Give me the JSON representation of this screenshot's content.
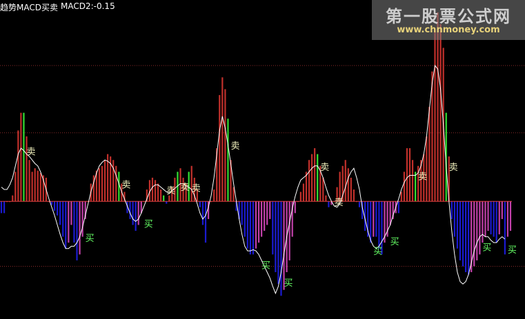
{
  "indicator": {
    "title": "趋势MACD买卖",
    "value_label": "MACD2:-0.15"
  },
  "watermark": {
    "name": "第一股票公式网",
    "url": "www.chnmoney.com"
  },
  "colors": {
    "positive_bar": "#c0302b",
    "negative_bar": "#1b1bd0",
    "weak_negative_bar": "#c040a8",
    "signal_bar": "#33dd33",
    "line": "#ffffff",
    "grid": "#8a2b2b",
    "zero_line": "#e04040",
    "signal_text": "#66ff66"
  },
  "chart_data": {
    "type": "bar",
    "title": "趋势MACD买卖",
    "legend": [
      "MACD2:-0.15"
    ],
    "grid": true,
    "ylim": [
      -0.95,
      1.6
    ],
    "gridlines": [
      1.15,
      0.58,
      -0.55
    ],
    "series": [
      {
        "name": "MACD2",
        "kind": "bar",
        "values": [
          -0.1,
          -0.1,
          0.0,
          0.0,
          0.05,
          0.25,
          0.6,
          0.75,
          0.75,
          0.55,
          0.35,
          0.25,
          0.28,
          0.26,
          0.24,
          0.22,
          0.2,
          0.0,
          -0.03,
          -0.08,
          -0.12,
          -0.2,
          -0.3,
          -0.4,
          -0.35,
          -0.2,
          -0.35,
          -0.5,
          -0.45,
          -0.3,
          -0.15,
          0.0,
          0.15,
          0.22,
          0.26,
          0.28,
          0.3,
          0.35,
          0.4,
          0.38,
          0.35,
          0.3,
          0.25,
          0.15,
          0.08,
          -0.1,
          -0.15,
          -0.2,
          -0.25,
          -0.2,
          -0.1,
          0.0,
          0.1,
          0.18,
          0.2,
          0.18,
          0.15,
          0.1,
          0.05,
          -0.02,
          0.05,
          0.12,
          0.2,
          0.25,
          0.28,
          0.2,
          0.15,
          0.25,
          0.3,
          0.2,
          0.1,
          -0.05,
          -0.2,
          -0.35,
          -0.15,
          0.0,
          0.1,
          0.45,
          0.9,
          1.05,
          0.95,
          0.7,
          0.35,
          0.12,
          -0.08,
          -0.15,
          -0.2,
          -0.3,
          -0.4,
          -0.45,
          -0.45,
          -0.4,
          -0.35,
          -0.3,
          -0.25,
          -0.2,
          -0.15,
          -0.45,
          -0.6,
          -0.7,
          -0.8,
          -0.75,
          -0.6,
          -0.5,
          -0.3,
          -0.1,
          0.0,
          0.08,
          0.15,
          0.25,
          0.35,
          0.4,
          0.45,
          0.4,
          0.3,
          0.2,
          0.05,
          -0.05,
          -0.03,
          0.0,
          0.12,
          0.25,
          0.3,
          0.35,
          0.28,
          0.2,
          0.1,
          0.0,
          -0.05,
          -0.15,
          -0.25,
          -0.3,
          -0.35,
          -0.3,
          -0.3,
          -0.4,
          -0.45,
          -0.35,
          -0.3,
          -0.2,
          -0.15,
          -0.1,
          -0.1,
          0.08,
          0.25,
          0.45,
          0.45,
          0.35,
          0.25,
          0.3,
          0.35,
          0.4,
          0.55,
          0.8,
          1.1,
          1.45,
          1.6,
          1.5,
          1.3,
          0.75,
          0.38,
          -0.15,
          -0.3,
          -0.4,
          -0.5,
          -0.55,
          -0.6,
          -0.62,
          -0.6,
          -0.55,
          -0.5,
          -0.45,
          -0.35,
          -0.3,
          -0.25,
          -0.28,
          -0.3,
          -0.35,
          -0.28,
          -0.15,
          -0.45,
          -0.3,
          -0.25
        ]
      },
      {
        "name": "trend",
        "kind": "line",
        "values": [
          0.12,
          0.1,
          0.1,
          0.14,
          0.2,
          0.3,
          0.4,
          0.45,
          0.43,
          0.4,
          0.38,
          0.35,
          0.32,
          0.3,
          0.25,
          0.18,
          0.1,
          0.02,
          -0.05,
          -0.12,
          -0.2,
          -0.28,
          -0.35,
          -0.4,
          -0.4,
          -0.38,
          -0.38,
          -0.35,
          -0.3,
          -0.22,
          -0.12,
          -0.02,
          0.08,
          0.16,
          0.24,
          0.3,
          0.33,
          0.35,
          0.34,
          0.32,
          0.28,
          0.22,
          0.15,
          0.08,
          0.02,
          -0.04,
          -0.1,
          -0.15,
          -0.17,
          -0.15,
          -0.1,
          -0.04,
          0.02,
          0.08,
          0.12,
          0.14,
          0.14,
          0.12,
          0.1,
          0.08,
          0.07,
          0.09,
          0.11,
          0.13,
          0.15,
          0.15,
          0.13,
          0.12,
          0.1,
          0.05,
          -0.02,
          -0.1,
          -0.15,
          -0.12,
          -0.05,
          0.05,
          0.2,
          0.4,
          0.6,
          0.72,
          0.62,
          0.48,
          0.32,
          0.15,
          0.0,
          -0.15,
          -0.28,
          -0.38,
          -0.42,
          -0.42,
          -0.41,
          -0.42,
          -0.45,
          -0.5,
          -0.55,
          -0.6,
          -0.65,
          -0.72,
          -0.78,
          -0.72,
          -0.6,
          -0.45,
          -0.3,
          -0.18,
          -0.06,
          0.04,
          0.12,
          0.18,
          0.2,
          0.22,
          0.25,
          0.28,
          0.3,
          0.3,
          0.26,
          0.2,
          0.12,
          0.05,
          0.0,
          -0.04,
          -0.05,
          -0.02,
          0.05,
          0.12,
          0.2,
          0.25,
          0.28,
          0.2,
          0.1,
          -0.05,
          -0.15,
          -0.25,
          -0.33,
          -0.38,
          -0.4,
          -0.38,
          -0.34,
          -0.3,
          -0.25,
          -0.2,
          -0.12,
          -0.05,
          0.02,
          0.1,
          0.16,
          0.2,
          0.22,
          0.22,
          0.22,
          0.24,
          0.3,
          0.4,
          0.55,
          0.78,
          1.0,
          1.15,
          1.12,
          0.95,
          0.65,
          0.3,
          0.0,
          -0.25,
          -0.45,
          -0.6,
          -0.68,
          -0.7,
          -0.68,
          -0.62,
          -0.52,
          -0.42,
          -0.35,
          -0.3,
          -0.28,
          -0.3,
          -0.3,
          -0.33,
          -0.35,
          -0.35,
          -0.32,
          -0.3,
          -0.32
        ]
      }
    ],
    "annotations": [
      {
        "label": "卖",
        "index": 8,
        "type": "sell"
      },
      {
        "label": "买",
        "index": 29,
        "type": "buy"
      },
      {
        "label": "卖",
        "index": 42,
        "type": "sell"
      },
      {
        "label": "买",
        "index": 50,
        "type": "buy"
      },
      {
        "label": "卖",
        "index": 58,
        "type": "sell"
      },
      {
        "label": "卖",
        "index": 63,
        "type": "sell"
      },
      {
        "label": "卖",
        "index": 67,
        "type": "sell"
      },
      {
        "label": "卖",
        "index": 81,
        "type": "sell"
      },
      {
        "label": "买",
        "index": 92,
        "type": "buy"
      },
      {
        "label": "买",
        "index": 100,
        "type": "buy"
      },
      {
        "label": "卖",
        "index": 113,
        "type": "sell"
      },
      {
        "label": "卖",
        "index": 118,
        "type": "sell"
      },
      {
        "label": "买",
        "index": 132,
        "type": "buy"
      },
      {
        "label": "买",
        "index": 138,
        "type": "buy"
      },
      {
        "label": "卖",
        "index": 148,
        "type": "sell"
      },
      {
        "label": "卖",
        "index": 159,
        "type": "sell"
      },
      {
        "label": "买",
        "index": 171,
        "type": "buy"
      },
      {
        "label": "买",
        "index": 180,
        "type": "buy"
      }
    ]
  }
}
